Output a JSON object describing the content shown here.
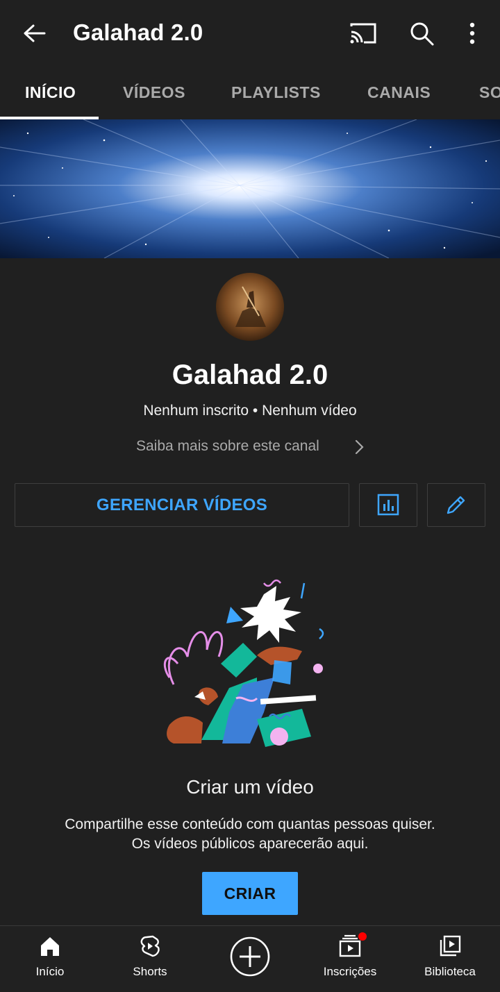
{
  "header": {
    "title": "Galahad 2.0",
    "icons": [
      "back-arrow-icon",
      "cast-icon",
      "search-icon",
      "more-vert-icon"
    ]
  },
  "tabs": [
    {
      "label": "INÍCIO",
      "active": true
    },
    {
      "label": "VÍDEOS",
      "active": false
    },
    {
      "label": "PLAYLISTS",
      "active": false
    },
    {
      "label": "CANAIS",
      "active": false
    },
    {
      "label": "SO",
      "active": false
    }
  ],
  "channel": {
    "name": "Galahad 2.0",
    "stats": "Nenhum inscrito • Nenhum vídeo",
    "more_link": "Saiba mais sobre este canal"
  },
  "actions": {
    "manage_label": "GERENCIAR VÍDEOS",
    "analytics_icon": "analytics-icon",
    "edit_icon": "edit-pencil-icon"
  },
  "empty_state": {
    "title": "Criar um vídeo",
    "description_line1": "Compartilhe esse conteúdo com quantas pessoas quiser.",
    "description_line2": "Os vídeos públicos aparecerão aqui.",
    "create_label": "CRIAR"
  },
  "bottom_nav": [
    {
      "label": "Início",
      "icon": "home-icon"
    },
    {
      "label": "Shorts",
      "icon": "shorts-icon"
    },
    {
      "label": "",
      "icon": "create-plus-icon"
    },
    {
      "label": "Inscrições",
      "icon": "subscriptions-icon",
      "badge": true
    },
    {
      "label": "Biblioteca",
      "icon": "library-icon"
    }
  ],
  "colors": {
    "background": "#202020",
    "accent": "#3ea6ff",
    "badge": "#ff0000"
  }
}
